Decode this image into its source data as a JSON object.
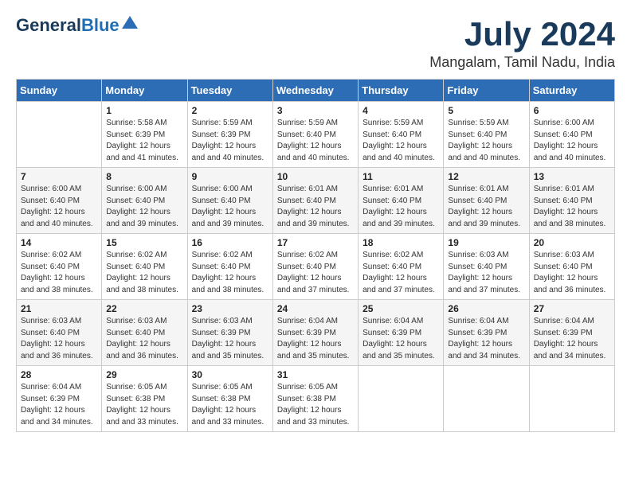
{
  "logo": {
    "line1": "General",
    "line2": "Blue"
  },
  "title": "July 2024",
  "location": "Mangalam, Tamil Nadu, India",
  "headers": [
    "Sunday",
    "Monday",
    "Tuesday",
    "Wednesday",
    "Thursday",
    "Friday",
    "Saturday"
  ],
  "weeks": [
    [
      {
        "day": "",
        "sunrise": "",
        "sunset": "",
        "daylight": ""
      },
      {
        "day": "1",
        "sunrise": "Sunrise: 5:58 AM",
        "sunset": "Sunset: 6:39 PM",
        "daylight": "Daylight: 12 hours and 41 minutes."
      },
      {
        "day": "2",
        "sunrise": "Sunrise: 5:59 AM",
        "sunset": "Sunset: 6:39 PM",
        "daylight": "Daylight: 12 hours and 40 minutes."
      },
      {
        "day": "3",
        "sunrise": "Sunrise: 5:59 AM",
        "sunset": "Sunset: 6:40 PM",
        "daylight": "Daylight: 12 hours and 40 minutes."
      },
      {
        "day": "4",
        "sunrise": "Sunrise: 5:59 AM",
        "sunset": "Sunset: 6:40 PM",
        "daylight": "Daylight: 12 hours and 40 minutes."
      },
      {
        "day": "5",
        "sunrise": "Sunrise: 5:59 AM",
        "sunset": "Sunset: 6:40 PM",
        "daylight": "Daylight: 12 hours and 40 minutes."
      },
      {
        "day": "6",
        "sunrise": "Sunrise: 6:00 AM",
        "sunset": "Sunset: 6:40 PM",
        "daylight": "Daylight: 12 hours and 40 minutes."
      }
    ],
    [
      {
        "day": "7",
        "sunrise": "Sunrise: 6:00 AM",
        "sunset": "Sunset: 6:40 PM",
        "daylight": "Daylight: 12 hours and 40 minutes."
      },
      {
        "day": "8",
        "sunrise": "Sunrise: 6:00 AM",
        "sunset": "Sunset: 6:40 PM",
        "daylight": "Daylight: 12 hours and 39 minutes."
      },
      {
        "day": "9",
        "sunrise": "Sunrise: 6:00 AM",
        "sunset": "Sunset: 6:40 PM",
        "daylight": "Daylight: 12 hours and 39 minutes."
      },
      {
        "day": "10",
        "sunrise": "Sunrise: 6:01 AM",
        "sunset": "Sunset: 6:40 PM",
        "daylight": "Daylight: 12 hours and 39 minutes."
      },
      {
        "day": "11",
        "sunrise": "Sunrise: 6:01 AM",
        "sunset": "Sunset: 6:40 PM",
        "daylight": "Daylight: 12 hours and 39 minutes."
      },
      {
        "day": "12",
        "sunrise": "Sunrise: 6:01 AM",
        "sunset": "Sunset: 6:40 PM",
        "daylight": "Daylight: 12 hours and 39 minutes."
      },
      {
        "day": "13",
        "sunrise": "Sunrise: 6:01 AM",
        "sunset": "Sunset: 6:40 PM",
        "daylight": "Daylight: 12 hours and 38 minutes."
      }
    ],
    [
      {
        "day": "14",
        "sunrise": "Sunrise: 6:02 AM",
        "sunset": "Sunset: 6:40 PM",
        "daylight": "Daylight: 12 hours and 38 minutes."
      },
      {
        "day": "15",
        "sunrise": "Sunrise: 6:02 AM",
        "sunset": "Sunset: 6:40 PM",
        "daylight": "Daylight: 12 hours and 38 minutes."
      },
      {
        "day": "16",
        "sunrise": "Sunrise: 6:02 AM",
        "sunset": "Sunset: 6:40 PM",
        "daylight": "Daylight: 12 hours and 38 minutes."
      },
      {
        "day": "17",
        "sunrise": "Sunrise: 6:02 AM",
        "sunset": "Sunset: 6:40 PM",
        "daylight": "Daylight: 12 hours and 37 minutes."
      },
      {
        "day": "18",
        "sunrise": "Sunrise: 6:02 AM",
        "sunset": "Sunset: 6:40 PM",
        "daylight": "Daylight: 12 hours and 37 minutes."
      },
      {
        "day": "19",
        "sunrise": "Sunrise: 6:03 AM",
        "sunset": "Sunset: 6:40 PM",
        "daylight": "Daylight: 12 hours and 37 minutes."
      },
      {
        "day": "20",
        "sunrise": "Sunrise: 6:03 AM",
        "sunset": "Sunset: 6:40 PM",
        "daylight": "Daylight: 12 hours and 36 minutes."
      }
    ],
    [
      {
        "day": "21",
        "sunrise": "Sunrise: 6:03 AM",
        "sunset": "Sunset: 6:40 PM",
        "daylight": "Daylight: 12 hours and 36 minutes."
      },
      {
        "day": "22",
        "sunrise": "Sunrise: 6:03 AM",
        "sunset": "Sunset: 6:40 PM",
        "daylight": "Daylight: 12 hours and 36 minutes."
      },
      {
        "day": "23",
        "sunrise": "Sunrise: 6:03 AM",
        "sunset": "Sunset: 6:39 PM",
        "daylight": "Daylight: 12 hours and 35 minutes."
      },
      {
        "day": "24",
        "sunrise": "Sunrise: 6:04 AM",
        "sunset": "Sunset: 6:39 PM",
        "daylight": "Daylight: 12 hours and 35 minutes."
      },
      {
        "day": "25",
        "sunrise": "Sunrise: 6:04 AM",
        "sunset": "Sunset: 6:39 PM",
        "daylight": "Daylight: 12 hours and 35 minutes."
      },
      {
        "day": "26",
        "sunrise": "Sunrise: 6:04 AM",
        "sunset": "Sunset: 6:39 PM",
        "daylight": "Daylight: 12 hours and 34 minutes."
      },
      {
        "day": "27",
        "sunrise": "Sunrise: 6:04 AM",
        "sunset": "Sunset: 6:39 PM",
        "daylight": "Daylight: 12 hours and 34 minutes."
      }
    ],
    [
      {
        "day": "28",
        "sunrise": "Sunrise: 6:04 AM",
        "sunset": "Sunset: 6:39 PM",
        "daylight": "Daylight: 12 hours and 34 minutes."
      },
      {
        "day": "29",
        "sunrise": "Sunrise: 6:05 AM",
        "sunset": "Sunset: 6:38 PM",
        "daylight": "Daylight: 12 hours and 33 minutes."
      },
      {
        "day": "30",
        "sunrise": "Sunrise: 6:05 AM",
        "sunset": "Sunset: 6:38 PM",
        "daylight": "Daylight: 12 hours and 33 minutes."
      },
      {
        "day": "31",
        "sunrise": "Sunrise: 6:05 AM",
        "sunset": "Sunset: 6:38 PM",
        "daylight": "Daylight: 12 hours and 33 minutes."
      },
      {
        "day": "",
        "sunrise": "",
        "sunset": "",
        "daylight": ""
      },
      {
        "day": "",
        "sunrise": "",
        "sunset": "",
        "daylight": ""
      },
      {
        "day": "",
        "sunrise": "",
        "sunset": "",
        "daylight": ""
      }
    ]
  ]
}
